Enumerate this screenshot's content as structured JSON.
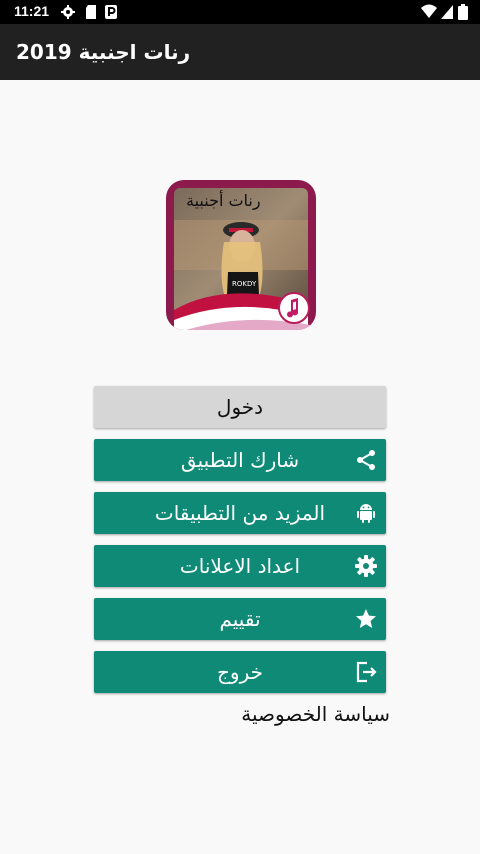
{
  "status_bar": {
    "time": "11:21",
    "icons": [
      "gear-icon",
      "sd-card-icon",
      "parking-icon",
      "wifi-icon",
      "signal-icon",
      "battery-icon"
    ]
  },
  "app_bar": {
    "title": "رنات اجنبية 2019"
  },
  "logo": {
    "caption": "رنات أجنبية",
    "shirt_text": "ROKDY",
    "music_icon": "music-note-icon"
  },
  "menu": {
    "login": "دخول",
    "share": "شارك التطبيق",
    "more_apps": "المزيد من التطبيقات",
    "ads_settings": "اعداد الاعلانات",
    "rate": "تقييم",
    "exit": "خروج",
    "icons": [
      "share-icon",
      "android-icon",
      "settings-icon",
      "star-icon",
      "exit-icon"
    ]
  },
  "privacy_link": "سياسة الخصوصية",
  "colors": {
    "button": "#0e8a76",
    "login_button": "#d5d6d5",
    "app_bar": "#212121",
    "background": "#f9f9f9"
  }
}
